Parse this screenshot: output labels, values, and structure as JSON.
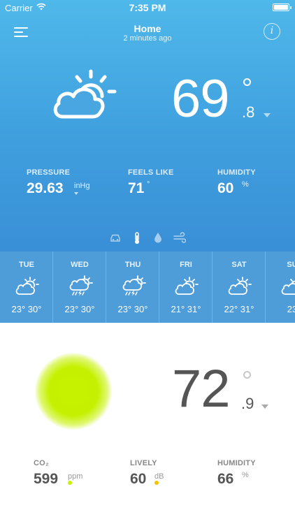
{
  "status_bar": {
    "carrier": "Carrier",
    "time": "7:35 PM"
  },
  "header": {
    "title": "Home",
    "subtitle": "2 minutes ago"
  },
  "outdoor": {
    "condition_icon": "partly-cloudy-icon",
    "temperature": {
      "integer": "69",
      "decimal": ".8"
    },
    "stats": {
      "pressure": {
        "label": "PRESSURE",
        "value": "29.63",
        "unit": "inHg"
      },
      "feels_like": {
        "label": "FEELS LIKE",
        "value": "71"
      },
      "humidity": {
        "label": "HUMIDITY",
        "value": "60",
        "unit": "%"
      }
    },
    "mode_icons": [
      "car-icon",
      "thermometer-icon",
      "water-drop-icon",
      "wind-icon"
    ]
  },
  "forecast": [
    {
      "day": "TUE",
      "icon": "partly-cloudy-icon",
      "temps": "23° 30°"
    },
    {
      "day": "WED",
      "icon": "thunderstorm-icon",
      "temps": "23° 30°"
    },
    {
      "day": "THU",
      "icon": "thunderstorm-icon",
      "temps": "23° 30°"
    },
    {
      "day": "FRI",
      "icon": "partly-cloudy-icon",
      "temps": "21° 31°"
    },
    {
      "day": "SAT",
      "icon": "partly-cloudy-icon",
      "temps": "22° 31°"
    },
    {
      "day": "SU",
      "icon": "partly-cloudy-icon",
      "temps": "23"
    }
  ],
  "indoor": {
    "status_color": "#c6f200",
    "temperature": {
      "integer": "72",
      "decimal": ".9"
    },
    "stats": {
      "co2": {
        "label": "CO₂",
        "value": "599",
        "unit": "ppm",
        "dot_color": "#c6f200"
      },
      "lively": {
        "label": "LIVELY",
        "value": "60",
        "unit": "dB",
        "dot_color": "#f5c400"
      },
      "humidity": {
        "label": "HUMIDITY",
        "value": "66",
        "unit": "%"
      }
    }
  }
}
